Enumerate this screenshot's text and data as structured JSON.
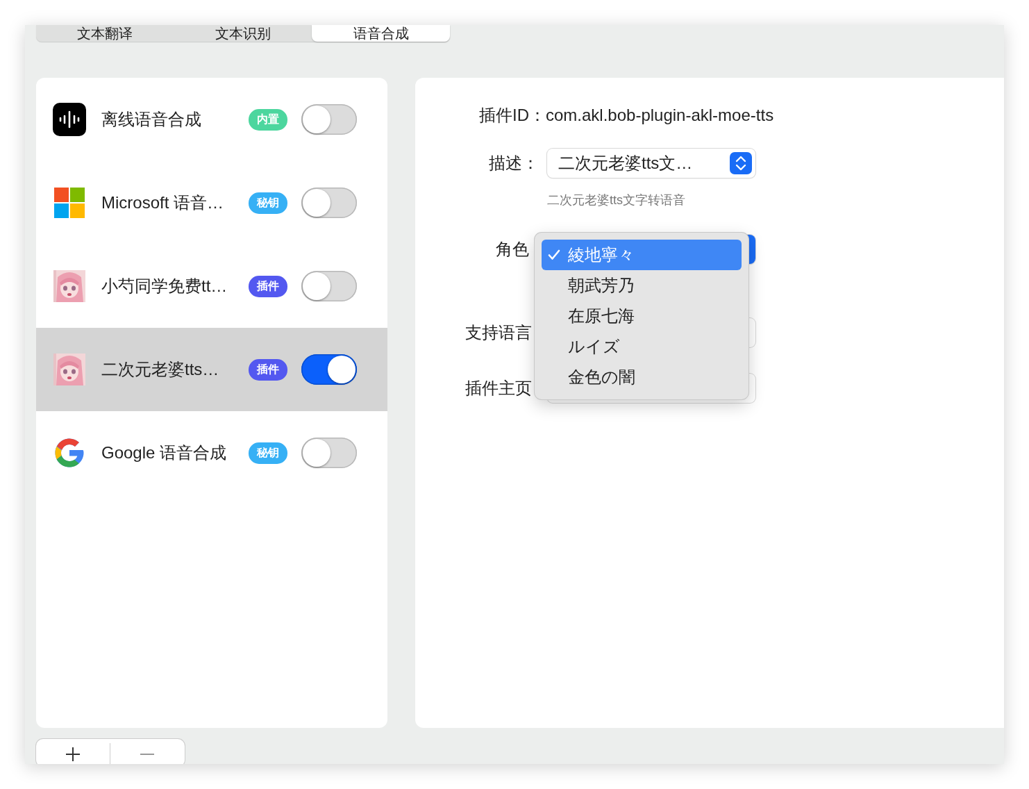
{
  "tabs": [
    {
      "label": "文本翻译",
      "selected": false
    },
    {
      "label": "文本识别",
      "selected": false
    },
    {
      "label": "语音合成",
      "selected": true
    }
  ],
  "engines": [
    {
      "name": "离线语音合成",
      "kind": "waveform",
      "badge": {
        "text": "内置",
        "color": "#4cd69e"
      },
      "enabled": false,
      "selected": false
    },
    {
      "name": "Microsoft 语音…",
      "kind": "squares",
      "badge": {
        "text": "秘钥",
        "color": "#36b0f5"
      },
      "enabled": false,
      "selected": false
    },
    {
      "name": "小芍同学免费tt…",
      "kind": "picture",
      "badge": {
        "text": "插件",
        "color": "#5358f0"
      },
      "enabled": false,
      "selected": false
    },
    {
      "name": "二次元老婆tts…",
      "kind": "picture",
      "badge": {
        "text": "插件",
        "color": "#5358f0"
      },
      "enabled": true,
      "selected": true
    },
    {
      "name": "Google 语音合成",
      "kind": "g",
      "badge": {
        "text": "秘钥",
        "color": "#36b0f5"
      },
      "enabled": false,
      "selected": false
    }
  ],
  "details": {
    "plugin_id": {
      "label": "插件ID：",
      "value": "com.akl.bob-plugin-akl-moe-tts"
    },
    "description": {
      "label": "描述：",
      "value": "二次元老婆tts文…",
      "hint": "二次元老婆tts文字转语音"
    },
    "role": {
      "label": "角色"
    },
    "languages": {
      "label": "支持语言"
    },
    "homepage": {
      "label": "插件主页"
    }
  },
  "role_menu": [
    {
      "label": "綾地寧々",
      "selected": true
    },
    {
      "label": "朝武芳乃",
      "selected": false
    },
    {
      "label": "在原七海",
      "selected": false
    },
    {
      "label": "ルイズ",
      "selected": false
    },
    {
      "label": "金色の闇",
      "selected": false
    }
  ]
}
